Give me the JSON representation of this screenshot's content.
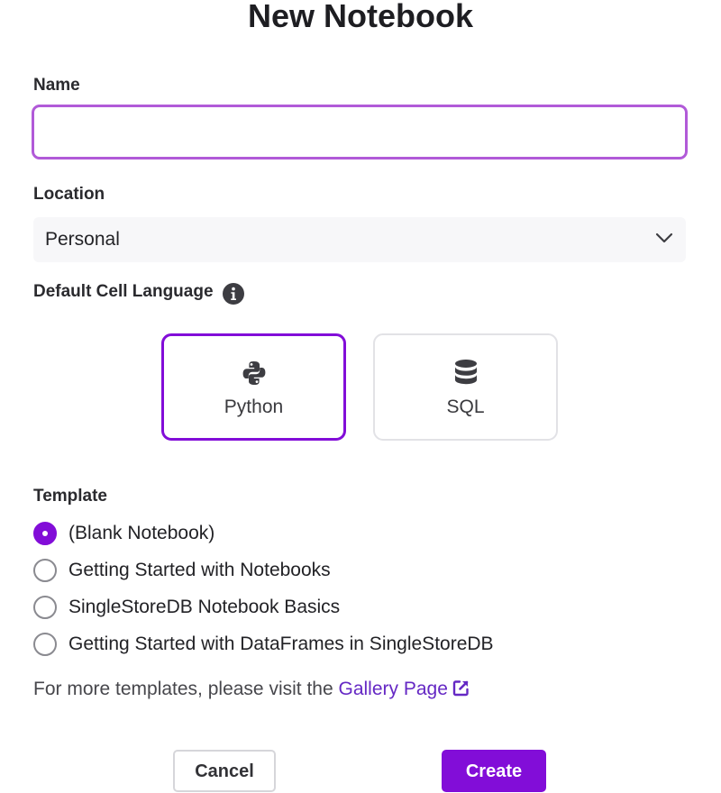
{
  "dialog": {
    "title": "New Notebook"
  },
  "name_field": {
    "label": "Name",
    "value": "",
    "placeholder": ""
  },
  "location_field": {
    "label": "Location",
    "selected": "Personal"
  },
  "cell_language": {
    "label": "Default Cell Language",
    "info_icon": "info-circle-icon",
    "options": [
      {
        "label": "Python",
        "icon": "python-icon",
        "selected": true
      },
      {
        "label": "SQL",
        "icon": "database-icon",
        "selected": false
      }
    ]
  },
  "template": {
    "label": "Template",
    "options": [
      {
        "label": "(Blank Notebook)",
        "checked": true
      },
      {
        "label": "Getting Started with Notebooks",
        "checked": false
      },
      {
        "label": "SingleStoreDB Notebook Basics",
        "checked": false
      },
      {
        "label": "Getting Started with DataFrames in SingleStoreDB",
        "checked": false
      }
    ],
    "gallery_prefix": "For more templates, please visit the ",
    "gallery_link": "Gallery Page",
    "gallery_icon": "external-link-icon"
  },
  "actions": {
    "cancel_label": "Cancel",
    "create_label": "Create"
  },
  "colors": {
    "accent": "#820dd8",
    "focus_border": "#b15ad8",
    "link": "#6528c4",
    "select_bg": "#f7f7f9",
    "icon_dark": "#3d3d42"
  }
}
